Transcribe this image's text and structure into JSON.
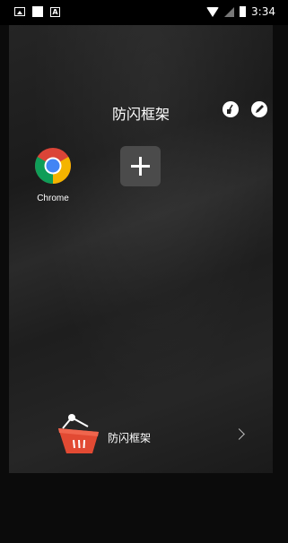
{
  "status_bar": {
    "time": "3:34",
    "icons": [
      "image-icon",
      "square-icon",
      "a-icon",
      "wifi-icon",
      "signal-icon",
      "battery-icon"
    ]
  },
  "panel": {
    "title": "防闪框架",
    "actions": [
      "clean-icon",
      "edit-icon"
    ]
  },
  "apps": [
    {
      "label": "Chrome",
      "icon": "chrome-icon"
    }
  ],
  "add_tile": {
    "icon": "plus-icon"
  },
  "bottom": {
    "label": "防闪框架",
    "icon": "basket-icon",
    "chevron": "chevron-right-icon"
  },
  "colors": {
    "panel_bg": "#1f1f1f",
    "add_tile_bg": "#4b4b4b",
    "basket_red": "#e24a33"
  }
}
